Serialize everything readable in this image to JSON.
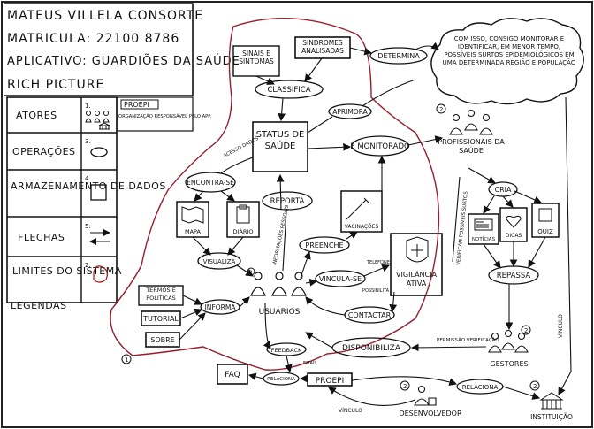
{
  "header": {
    "name": "MATEUS VILLELA CONSORTE",
    "matricula": "MATRICULA: 22100 8786",
    "aplicativo": "APLICATIVO: GUARDIÕES DA SAÚDE",
    "title": "RICH PICTURE"
  },
  "legend": {
    "rows": [
      {
        "label": "ATORES",
        "num": "1."
      },
      {
        "label": "OPERAÇÕES",
        "num": "3."
      },
      {
        "label": "ARMAZENAMENTO DE DADOS",
        "num": "4."
      },
      {
        "label": "FLECHAS",
        "num": "5."
      },
      {
        "label": "LIMITES DO SISTEMA",
        "num": "2."
      }
    ],
    "footer": "LEGENDAS",
    "proepi_tag": "PROEPI",
    "proepi_note": "ORGANIZAÇÃO RESPONSÁVEL PELO APP."
  },
  "cloud_text": "COM ISSO, CONSIGO MONITORAR E IDENTIFICAR, EM MENOR TEMPO, POSSÍVEIS SURTOS EPIDEMIOLÓGICOS EM UMA DETERMINADA REGIÃO E POPULAÇÃO",
  "nodes": {
    "sinais": "SINAIS E SINTOMAS",
    "sindromes": "SINDROMES ANALISADAS",
    "determina": "DETERMINA",
    "classifica": "CLASSIFICA",
    "aprimora": "APRIMORA",
    "status": "STATUS DE SAÚDE",
    "monitorado": "É MONITORADO",
    "encontra": "ENCONTRA-SE",
    "reporta": "REPORTA",
    "mapa": "MAPA",
    "diario": "DIÁRIO",
    "vacinacoes": "VACINAÇÕES",
    "preenche": "PREENCHE",
    "visualiza": "VISUALIZA",
    "vigilancia": "VIGILÂNCIA ATIVA",
    "vincula": "VINCULA-SE",
    "contactar": "CONTACTAR",
    "usuarios": "USUÁRIOS",
    "termos": "TERMOS E POLÍTICAS",
    "tutorial": "TUTORIAL",
    "sobre": "SOBRE",
    "informa": "INFORMA",
    "feedback": "FEEDBACK",
    "disponibiliza": "DISPONIBILIZA",
    "faq": "FAQ",
    "proepi": "PROEPI",
    "relaciona_left": "RELACIONA",
    "relaciona_right": "RELACIONA",
    "profissionais": "PROFISSIONAIS DA SAÚDE",
    "cria": "CRIA",
    "noticias": "NOTÍCIAS",
    "dicas": "DICAS",
    "quiz": "QUIZ",
    "repassa": "REPASSA",
    "gestores": "GESTORES",
    "desenvolvedor": "DESENVOLVEDOR",
    "instituicao": "INSTITUIÇÃO"
  },
  "edge_labels": {
    "acesso_dados": "ACESSO DADOS",
    "informacoes": "INFORMAÇÕES PESSOAIS",
    "vinculo": "VÍNCULO",
    "vinculo2": "VÍNCULO",
    "telefone": "TELEFONE",
    "possibilita": "POSSIBILITA",
    "verifica": "VERIFICAM POSSÍVEIS SURTOS",
    "permissao": "PERMISSÃO VERIFICAÇÃO",
    "email": "EMAIL"
  },
  "markers": {
    "m1": "1",
    "m2": "2",
    "m3": "2",
    "m4": "2",
    "m5": "2",
    "m6": "2"
  }
}
